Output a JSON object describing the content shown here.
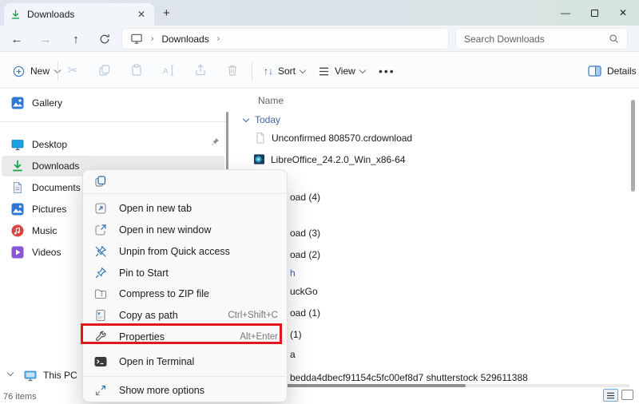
{
  "titlebar": {
    "tab_label": "Downloads"
  },
  "navbar": {
    "breadcrumb_root": "Downloads",
    "search_placeholder": "Search Downloads"
  },
  "toolbar": {
    "new": "New",
    "sort": "Sort",
    "view": "View",
    "more": "•••",
    "details": "Details"
  },
  "sidebar": {
    "items": [
      {
        "label": "Gallery"
      },
      {
        "label": "Desktop",
        "pinned": true
      },
      {
        "label": "Downloads",
        "selected": true
      },
      {
        "label": "Documents"
      },
      {
        "label": "Pictures"
      },
      {
        "label": "Music"
      },
      {
        "label": "Videos"
      },
      {
        "label": "This PC"
      }
    ]
  },
  "filelist": {
    "name_column": "Name",
    "group_today": "Today",
    "rows": [
      {
        "text": "Unconfirmed 808570.crdownload"
      },
      {
        "text": "LibreOffice_24.2.0_Win_x86-64"
      },
      {
        "text": "oad (4)"
      },
      {
        "text": "oad (3)"
      },
      {
        "text": "oad (2)"
      },
      {
        "text": "h"
      },
      {
        "text": "uckGo"
      },
      {
        "text": "oad (1)"
      },
      {
        "text": "(1)"
      },
      {
        "text": "a"
      },
      {
        "text": "bedda4dbecf91154c5fc00ef8d7 shutterstock 529611388"
      }
    ]
  },
  "context_menu": {
    "items": [
      {
        "label": "Open in new tab"
      },
      {
        "label": "Open in new window"
      },
      {
        "label": "Unpin from Quick access"
      },
      {
        "label": "Pin to Start"
      },
      {
        "label": "Compress to ZIP file"
      },
      {
        "label": "Copy as path",
        "shortcut": "Ctrl+Shift+C"
      },
      {
        "label": "Properties",
        "shortcut": "Alt+Enter",
        "highlighted": true
      },
      {
        "label": "Open in Terminal"
      },
      {
        "label": "Show more options"
      }
    ]
  },
  "statusbar": {
    "items_count": "76 items"
  },
  "colors": {
    "accent_blue": "#3b77bd",
    "download_green": "#17a34a",
    "highlight_red": "#e0171f",
    "group_blue": "#44659f"
  }
}
